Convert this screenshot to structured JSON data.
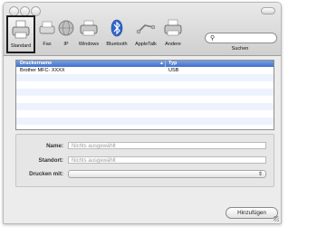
{
  "toolbar": {
    "items": [
      {
        "label": "Standard",
        "icon": "printer-icon",
        "selected": true
      },
      {
        "label": "Fax",
        "icon": "fax-icon"
      },
      {
        "label": "IP",
        "icon": "globe-icon"
      },
      {
        "label": "Windows",
        "icon": "windows-printer-icon"
      },
      {
        "label": "Bluetooth",
        "icon": "bluetooth-icon"
      },
      {
        "label": "AppleTalk",
        "icon": "appletalk-icon"
      },
      {
        "label": "Andere",
        "icon": "other-printer-icon"
      }
    ],
    "search_label": "Suchen",
    "search_placeholder": ""
  },
  "list": {
    "columns": [
      "Druckername",
      "Typ"
    ],
    "rows": [
      {
        "name": "Brother MFC- XXXX",
        "type": "USB"
      }
    ]
  },
  "form": {
    "name_label": "Name:",
    "name_value": "Nichts ausgewählt",
    "location_label": "Standort:",
    "location_value": "Nichts ausgewählt",
    "print_with_label": "Drucken mit:",
    "print_with_value": ""
  },
  "buttons": {
    "add": "Hinzufügen"
  },
  "colors": {
    "header": "#4a78d4",
    "stripe": "#edf3fe"
  }
}
